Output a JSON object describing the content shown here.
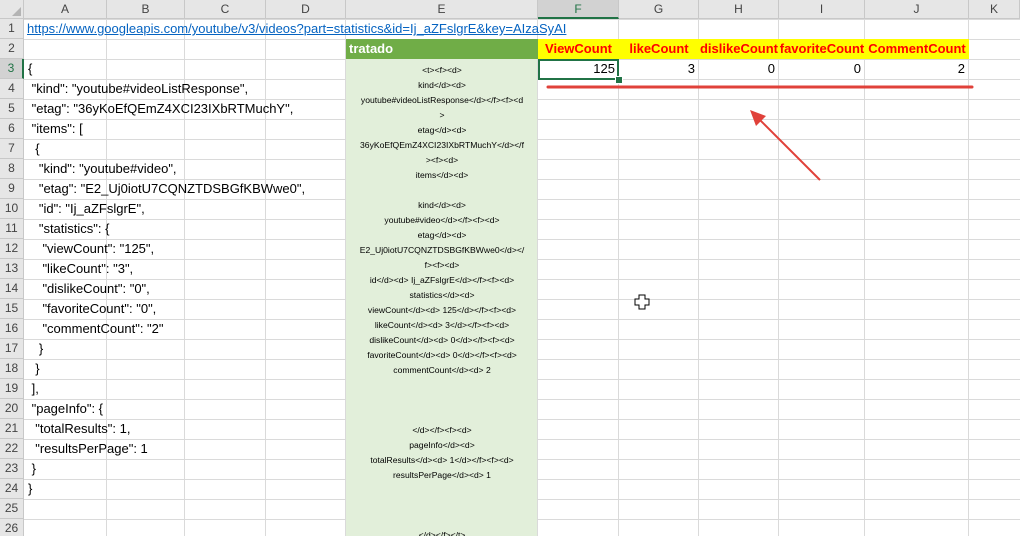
{
  "columns": [
    "A",
    "B",
    "C",
    "D",
    "E",
    "F",
    "G",
    "H",
    "I",
    "J",
    "K"
  ],
  "rows": [
    "1",
    "2",
    "3",
    "4",
    "5",
    "6",
    "7",
    "8",
    "9",
    "10",
    "11",
    "12",
    "13",
    "14",
    "15",
    "16",
    "17",
    "18",
    "19",
    "20",
    "21",
    "22",
    "23",
    "24",
    "25",
    "26"
  ],
  "url_cell": "https://www.googleapis.com/youtube/v3/videos?part=statistics&id=Ij_aZFslgrE&key=AIzaSyAI",
  "json_lines": [
    "{",
    " \"kind\": \"youtube#videoListResponse\",",
    " \"etag\": \"36yKoEfQEmZ4XCI23IXbRTMuchY\",",
    " \"items\": [",
    "  {",
    "   \"kind\": \"youtube#video\",",
    "   \"etag\": \"E2_Uj0iotU7CQNZTDSBGfKBWwe0\",",
    "   \"id\": \"Ij_aZFslgrE\",",
    "   \"statistics\": {",
    "    \"viewCount\": \"125\",",
    "    \"likeCount\": \"3\",",
    "    \"dislikeCount\": \"0\",",
    "    \"favoriteCount\": \"0\",",
    "    \"commentCount\": \"2\"",
    "   }",
    "  }",
    " ],",
    " \"pageInfo\": {",
    "  \"totalResults\": 1,",
    "  \"resultsPerPage\": 1",
    " }",
    "}"
  ],
  "tratado_header": "tratado",
  "tratado_lines": [
    "<t><f><d>",
    "kind</d><d>",
    "youtube#videoListResponse</d></f><f><d",
    ">",
    "etag</d><d>",
    "36yKoEfQEmZ4XCI23IXbRTMuchY</d></f",
    "><f><d>",
    "items</d><d>",
    "",
    "kind</d><d>",
    "youtube#video</d></f><f><d>",
    "etag</d><d>",
    "E2_Uj0iotU7CQNZTDSBGfKBWwe0</d></",
    "f><f><d>",
    "id</d><d> Ij_aZFslgrE</d></f><f><d>",
    "statistics</d><d>",
    "viewCount</d><d> 125</d></f><f><d>",
    "likeCount</d><d> 3</d></f><f><d>",
    "dislikeCount</d><d> 0</d></f><f><d>",
    "favoriteCount</d><d> 0</d></f><f><d>",
    "commentCount</d><d> 2",
    "",
    "",
    "",
    "</d></f><f><d>",
    "pageInfo</d><d>",
    "totalResults</d><d> 1</d></f><f><d>",
    "resultsPerPage</d><d> 1",
    "",
    "",
    "",
    "</d></f></t>"
  ],
  "stat_headers": [
    "ViewCount",
    "likeCount",
    "dislikeCount",
    "favoriteCount",
    "CommentCount"
  ],
  "stat_values": [
    "125",
    "3",
    "0",
    "0",
    "2"
  ],
  "colors": {
    "green_header": "#70ad47",
    "green_fill": "#e2efda",
    "yellow": "#ffff00",
    "red_text": "#ff0000",
    "annotation_red": "#e0413a",
    "selection": "#217346",
    "link": "#0563c1"
  },
  "icons": {
    "cursor": "plus-cursor-icon"
  }
}
